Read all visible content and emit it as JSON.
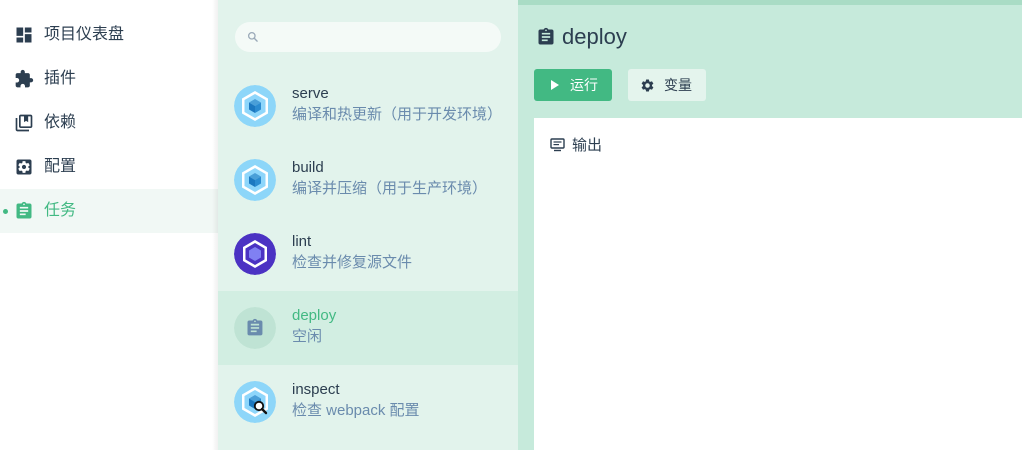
{
  "nav": {
    "items": [
      {
        "label": "项目仪表盘",
        "icon": "dashboard-icon"
      },
      {
        "label": "插件",
        "icon": "puzzle-icon"
      },
      {
        "label": "依赖",
        "icon": "library-icon"
      },
      {
        "label": "配置",
        "icon": "settings-icon"
      },
      {
        "label": "任务",
        "icon": "assignment-icon",
        "active": true
      }
    ]
  },
  "search": {
    "placeholder": "",
    "value": ""
  },
  "tasks": [
    {
      "name": "serve",
      "description": "编译和热更新（用于开发环境）",
      "icon": "webpack-icon"
    },
    {
      "name": "build",
      "description": "编译并压缩（用于生产环境）",
      "icon": "webpack-icon"
    },
    {
      "name": "lint",
      "description": "检查并修复源文件",
      "icon": "eslint-icon"
    },
    {
      "name": "deploy",
      "description": "空闲",
      "icon": "assignment-icon",
      "active": true
    },
    {
      "name": "inspect",
      "description": "检查 webpack 配置",
      "icon": "webpack-inspect-icon"
    }
  ],
  "main": {
    "title": "deploy",
    "run_label": "运行",
    "variables_label": "变量",
    "output_label": "输出"
  },
  "colors": {
    "accent": "#42b983",
    "text": "#2c3e50",
    "muted": "#6a8bad",
    "task_list_bg": "#e2f3ec",
    "main_bg": "#c6eadb"
  }
}
